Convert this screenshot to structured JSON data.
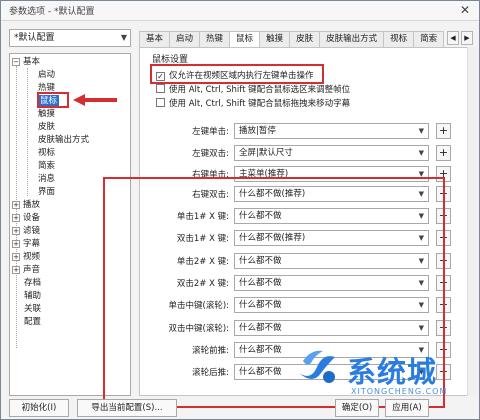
{
  "window": {
    "title": "参数选项 - *默认配置",
    "close_glyph": "✕"
  },
  "profile": {
    "value": "*默认配置"
  },
  "tree": {
    "items": [
      {
        "label": "基本",
        "toggle": "−"
      },
      {
        "label": "启动"
      },
      {
        "label": "热键"
      },
      {
        "label": "鼠标"
      },
      {
        "label": "触摸"
      },
      {
        "label": "皮肤"
      },
      {
        "label": "皮肤输出方式"
      },
      {
        "label": "视标"
      },
      {
        "label": "简索"
      },
      {
        "label": "消息"
      },
      {
        "label": "界面"
      },
      {
        "label": "播放",
        "toggle": "+"
      },
      {
        "label": "设备",
        "toggle": "+"
      },
      {
        "label": "滤镜",
        "toggle": "+"
      },
      {
        "label": "字幕",
        "toggle": "+"
      },
      {
        "label": "视频",
        "toggle": "+"
      },
      {
        "label": "声音",
        "toggle": "+"
      },
      {
        "label": "存档"
      },
      {
        "label": "辅助"
      },
      {
        "label": "关联"
      },
      {
        "label": "配置"
      }
    ]
  },
  "tabs": [
    "基本",
    "启动",
    "热键",
    "鼠标",
    "触摸",
    "皮肤",
    "皮肤输出方式",
    "视标",
    "简索"
  ],
  "section": {
    "title": "鼠标设置",
    "checkboxes": [
      {
        "label": "仅允许在视频区域内执行左键单击操作",
        "checked": true
      },
      {
        "label": "使用 Alt, Ctrl, Shift 键配合鼠标选区来调整帧位",
        "checked": false
      },
      {
        "label": "使用 Alt, Ctrl, Shift 键配合鼠标拖拽来移动字幕",
        "checked": false
      }
    ]
  },
  "settings": [
    {
      "label": "左键单击:",
      "value": "播放|暂停"
    },
    {
      "label": "左键双击:",
      "value": "全屏|默认尺寸"
    },
    {
      "label": "右键单击:",
      "value": "主菜单(推荐)"
    },
    {
      "label": "右键双击:",
      "value": "什么都不做(推荐)"
    },
    {
      "label": "单击1# X 键:",
      "value": "什么都不做"
    },
    {
      "label": "双击1# X 键:",
      "value": "什么都不做(推荐)"
    },
    {
      "label": "单击2# X 键:",
      "value": "什么都不做"
    },
    {
      "label": "双击2# X 键:",
      "value": "什么都不做"
    },
    {
      "label": "单击中键(滚轮):",
      "value": "什么都不做"
    },
    {
      "label": "双击中键(滚轮):",
      "value": "什么都不做"
    },
    {
      "label": "滚轮前推:",
      "value": "什么都不做"
    },
    {
      "label": "滚轮后推:",
      "value": "什么都不做"
    }
  ],
  "buttons": {
    "init": "初始化(I)",
    "export": "导出当前配置(S)...",
    "ok": "确定(O)",
    "apply": "应用(A)"
  },
  "watermark": {
    "text": "系统城",
    "sub": "XITONGCHENG.COM"
  },
  "colors": {
    "highlight_red": "#d42d32",
    "selection_blue": "#2f6fd0",
    "watermark_blue": "#2a7de0"
  }
}
